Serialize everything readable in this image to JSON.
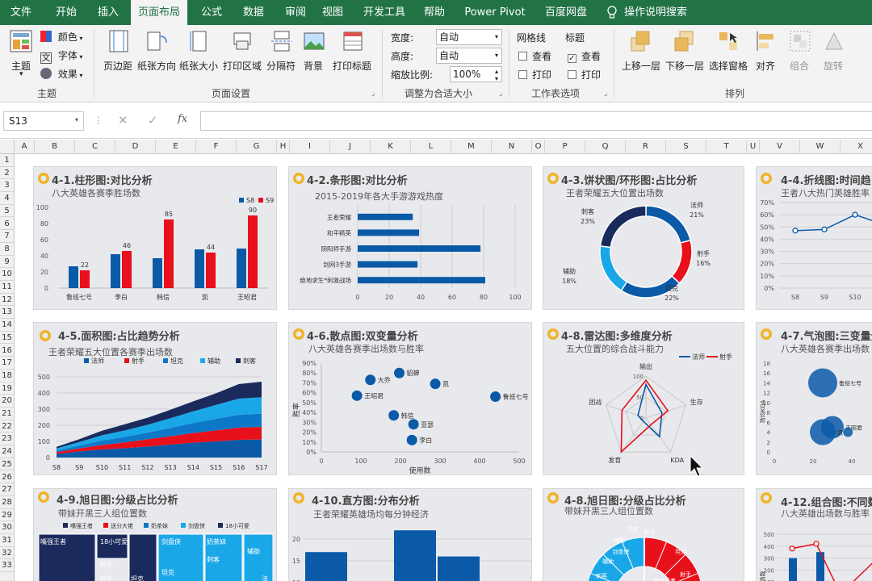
{
  "tabs": [
    "文件",
    "开始",
    "插入",
    "页面布局",
    "公式",
    "数据",
    "审阅",
    "视图",
    "开发工具",
    "帮助",
    "Power Pivot",
    "百度网盘",
    "操作说明搜索"
  ],
  "ribbon": {
    "theme": {
      "label": "主题",
      "colors": "颜色",
      "fonts": "字体",
      "effects": "效果",
      "group": "主题"
    },
    "page_setup": {
      "margins": "页边距",
      "orientation": "纸张方向",
      "size": "纸张大小",
      "print_area": "打印区域",
      "breaks": "分隔符",
      "background": "背景",
      "print_titles": "打印标题",
      "group": "页面设置"
    },
    "scale": {
      "width_label": "宽度:",
      "width_value": "自动",
      "height_label": "高度:",
      "height_value": "自动",
      "scale_label": "缩放比例:",
      "scale_value": "100%",
      "group": "调整为合适大小"
    },
    "sheet_options": {
      "gridlines": "网格线",
      "headings": "标题",
      "view1": "查看",
      "print1": "打印",
      "view2": "查看",
      "print2": "打印",
      "group": "工作表选项"
    },
    "arrange": {
      "bring_forward": "上移一层",
      "send_backward": "下移一层",
      "selection_pane": "选择窗格",
      "align": "对齐",
      "group_btn": "组合",
      "rotate": "旋转",
      "group": "排列"
    }
  },
  "formula_bar": {
    "name_box": "S13",
    "fx": "fx",
    "formula": ""
  },
  "columns": [
    "A",
    "B",
    "C",
    "D",
    "E",
    "F",
    "G",
    "H",
    "I",
    "J",
    "K",
    "L",
    "M",
    "N",
    "O",
    "P",
    "Q",
    "R",
    "S",
    "T",
    "U",
    "V",
    "W",
    "X"
  ],
  "rows": [
    "1",
    "2",
    "3",
    "4",
    "5",
    "6",
    "7",
    "8",
    "9",
    "10",
    "11",
    "12",
    "13",
    "14",
    "15",
    "16",
    "17",
    "18",
    "19",
    "20",
    "21",
    "22",
    "23",
    "24",
    "25",
    "26",
    "27",
    "28",
    "29",
    "30",
    "31",
    "32",
    "33"
  ],
  "colors": {
    "ribbon_green": "#217346",
    "s8": "#0b5aa8",
    "s9": "#e8101a",
    "navy": "#1b2a5c",
    "cyan": "#1aa7e8",
    "panel": "#e8e9ed"
  },
  "panels": {
    "p1": {
      "title": "4-1.柱形图:对比分析",
      "subtitle": "八大英雄各赛季胜场数"
    },
    "p2": {
      "title": "4-2.条形图:对比分析",
      "subtitle": "2015-2019年各大手游游戏热度"
    },
    "p3": {
      "title": "4-3.饼状图/环形图:占比分析",
      "subtitle": "王者荣耀五大位置出场数"
    },
    "p4": {
      "title": "4-4.折线图:时间趋",
      "subtitle": "王者八大热门英雄胜率"
    },
    "p5": {
      "title": "4-5.面积图:占比趋势分析",
      "subtitle": "王者荣耀五大位置各赛季出场数"
    },
    "p6": {
      "title": "4-6.散点图:双变量分析",
      "subtitle": "八大英雄各赛季出场数与胜率"
    },
    "p7": {
      "title": "4-8.雷达图:多维度分析",
      "subtitle": "五大位置的综合战斗能力"
    },
    "p8": {
      "title": "4-7.气泡图:三变量分",
      "subtitle": "八大英雄各赛季出场数"
    },
    "p9": {
      "title": "4-9.旭日图:分级占比分析",
      "subtitle": "带妹开黑三人组位置数"
    },
    "p10": {
      "title": "4-10.直方图:分布分析",
      "subtitle": "王者荣耀英雄场均每分钟经济"
    },
    "p11": {
      "title": "4-8.旭日图:分级占比分析",
      "subtitle": "带妹开黑三人组位置数"
    },
    "p12": {
      "title": "4-12.组合图:不同数",
      "subtitle": "八大英雄出场数与胜率"
    }
  },
  "chart_data": [
    {
      "id": "c1",
      "type": "bar",
      "categories": [
        "鲁班七号",
        "李白",
        "韩信",
        "凯",
        "王昭君"
      ],
      "series": [
        {
          "name": "S8",
          "values": [
            27,
            42,
            37,
            48,
            49
          ]
        },
        {
          "name": "S9",
          "values": [
            22,
            46,
            85,
            44,
            90
          ]
        }
      ],
      "data_labels_s9": [
        "22",
        "46",
        "85",
        "44",
        "90"
      ],
      "yticks": [
        "0",
        "20",
        "40",
        "60",
        "80",
        "100"
      ],
      "ylim": [
        0,
        100
      ]
    },
    {
      "id": "c2",
      "type": "bar",
      "orientation": "horizontal",
      "categories": [
        "王者荣耀",
        "和平精英",
        "阴阳师手游",
        "剑网3手游",
        "绝地求生*刺激战场"
      ],
      "values": [
        35,
        39,
        78,
        38,
        81
      ],
      "xticks": [
        "0",
        "20",
        "40",
        "60",
        "80",
        "100"
      ],
      "xlim": [
        0,
        100
      ]
    },
    {
      "id": "c3",
      "type": "pie",
      "donut": true,
      "slices": [
        {
          "name": "法师",
          "label": "21%",
          "value": 21
        },
        {
          "name": "射手",
          "label": "16%",
          "value": 16
        },
        {
          "name": "坦克",
          "label": "22%",
          "value": 22
        },
        {
          "name": "辅助",
          "label": "18%",
          "value": 18
        },
        {
          "name": "刺客",
          "label": "23%",
          "value": 23
        }
      ]
    },
    {
      "id": "c4",
      "type": "line",
      "categories": [
        "S8",
        "S9",
        "S10"
      ],
      "values": [
        47,
        48,
        60,
        52
      ],
      "yticks": [
        "0%",
        "10%",
        "20%",
        "30%",
        "40%",
        "50%",
        "60%",
        "70%"
      ],
      "ylim": [
        0,
        70
      ]
    },
    {
      "id": "c5",
      "type": "area",
      "stacked": true,
      "categories": [
        "S8",
        "S9",
        "S10",
        "S11",
        "S12",
        "S13",
        "S14",
        "S15",
        "S16",
        "S17"
      ],
      "series": [
        {
          "name": "法师",
          "values": [
            22,
            38,
            50,
            58,
            68,
            80,
            92,
            100,
            110,
            112
          ]
        },
        {
          "name": "射手",
          "values": [
            12,
            18,
            28,
            36,
            45,
            52,
            60,
            68,
            75,
            78
          ]
        },
        {
          "name": "坦克",
          "values": [
            10,
            18,
            28,
            34,
            42,
            52,
            62,
            72,
            80,
            82
          ]
        },
        {
          "name": "辅助",
          "values": [
            12,
            22,
            32,
            40,
            48,
            60,
            72,
            86,
            100,
            102
          ]
        },
        {
          "name": "刺客",
          "values": [
            10,
            18,
            28,
            38,
            44,
            52,
            62,
            72,
            90,
            96
          ]
        }
      ],
      "yticks": [
        "0",
        "100",
        "200",
        "300",
        "400",
        "500"
      ],
      "ylim": [
        0,
        500
      ]
    },
    {
      "id": "c6",
      "type": "scatter",
      "ylabel": "胜率",
      "xlabel": "使用数",
      "points": [
        {
          "name": "貂蝉",
          "x": 197,
          "y": 80
        },
        {
          "name": "大乔",
          "x": 124,
          "y": 73
        },
        {
          "name": "凯",
          "x": 288,
          "y": 69
        },
        {
          "name": "王昭君",
          "x": 90,
          "y": 57
        },
        {
          "name": "鲁班七号",
          "x": 440,
          "y": 56
        },
        {
          "name": "韩信",
          "x": 183,
          "y": 37
        },
        {
          "name": "亚瑟",
          "x": 233,
          "y": 28
        },
        {
          "name": "李白",
          "x": 229,
          "y": 12
        }
      ],
      "xticks": [
        "0",
        "100",
        "200",
        "300",
        "400",
        "500"
      ],
      "xlim": [
        0,
        500
      ],
      "yticks": [
        "0%",
        "10%",
        "20%",
        "30%",
        "40%",
        "50%",
        "60%",
        "70%",
        "80%",
        "90%"
      ],
      "ylim": [
        0,
        90
      ]
    },
    {
      "id": "c7",
      "type": "radar",
      "axes": [
        "输出",
        "生存",
        "KDA",
        "发育",
        "团战"
      ],
      "ticks": [
        "0",
        "50",
        "100"
      ],
      "series": [
        {
          "name": "法师",
          "values": [
            80,
            40,
            55,
            10,
            20
          ]
        },
        {
          "name": "射手",
          "values": [
            90,
            55,
            20,
            100,
            60
          ]
        }
      ]
    },
    {
      "id": "c8",
      "type": "scatter",
      "bubble": true,
      "ylabel": "场均KDA",
      "points": [
        {
          "name": "鲁班七号",
          "x": 25,
          "y": 14,
          "r": 18
        },
        {
          "name": "王昭君",
          "x": 30,
          "y": 5,
          "r": 14
        },
        {
          "name": "凯",
          "x": 25,
          "y": 4,
          "r": 16
        },
        {
          "name": "",
          "x": 38,
          "y": 4,
          "r": 6
        }
      ],
      "xticks": [
        "0",
        "20",
        "40"
      ],
      "yticks": [
        "0",
        "2",
        "4",
        "6",
        "8",
        "10",
        "12",
        "14",
        "16",
        "18"
      ]
    },
    {
      "id": "c9",
      "type": "treemap",
      "legend": [
        "嘴强王者",
        "送分大佬",
        "奶茶妹",
        "剑盘侠",
        "18小可爱"
      ],
      "cells_text": [
        "嘴强王者",
        "18小可爱",
        "剑盘侠",
        "奶茶妹",
        "辅助",
        "坦克",
        "射手",
        "刺客",
        "射手",
        "坦克",
        "法"
      ]
    },
    {
      "id": "c10",
      "type": "histogram",
      "yticks": [
        "10",
        "15",
        "20"
      ],
      "values": [
        17,
        0,
        22,
        16
      ]
    },
    {
      "id": "c11",
      "type": "sunburst",
      "labels": [
        "嘴强王者",
        "坦克",
        "射手",
        "辅助",
        "刺客",
        "剑盘侠",
        "坦克",
        "射手",
        "辅助"
      ]
    },
    {
      "id": "c12",
      "type": "line",
      "yticks": [
        "0",
        "100",
        "200",
        "300",
        "400",
        "500"
      ],
      "ylabel": "出场数",
      "values": [
        380,
        420,
        0,
        300
      ]
    }
  ]
}
